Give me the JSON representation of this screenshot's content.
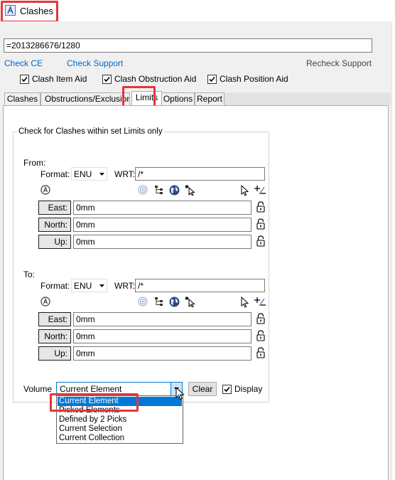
{
  "window": {
    "title": "Clashes"
  },
  "ref_field": {
    "value": "=2013286676/1280"
  },
  "links": {
    "check_ce": "Check CE",
    "check_support": "Check Support",
    "recheck_support": "Recheck Support"
  },
  "checkboxes": [
    {
      "label": "Clash Item Aid",
      "checked": true
    },
    {
      "label": "Clash Obstruction Aid",
      "checked": true
    },
    {
      "label": "Clash Position Aid",
      "checked": true
    }
  ],
  "tabs": [
    "Clashes",
    "Obstructions/Exclusions",
    "Limits",
    "Options",
    "Report"
  ],
  "active_tab": "Limits",
  "limits": {
    "group_title": "Check for Clashes within set Limits only",
    "from": {
      "label": "From:",
      "format_label": "Format:",
      "format_value": "ENU",
      "wrt_label": "WRT:",
      "wrt_value": "/*",
      "east_label": "East:",
      "east_value": "0mm",
      "north_label": "North:",
      "north_value": "0mm",
      "up_label": "Up:",
      "up_value": "0mm"
    },
    "to": {
      "label": "To:",
      "format_label": "Format:",
      "format_value": "ENU",
      "wrt_label": "WRT:",
      "wrt_value": "/*",
      "east_label": "East:",
      "east_value": "0mm",
      "north_label": "North:",
      "north_value": "0mm",
      "up_label": "Up:",
      "up_value": "0mm"
    },
    "volume": {
      "label": "Volume",
      "selected": "Current Element",
      "clear_label": "Clear",
      "display_label": "Display",
      "display_checked": true,
      "options": [
        "Current Element",
        "Picked Elements",
        "Defined by 2 Picks",
        "Current Selection",
        "Current Collection"
      ]
    }
  },
  "colors": {
    "highlight_red": "#e2373c",
    "selection_blue": "#0078d7",
    "link_blue": "#0066cc"
  }
}
